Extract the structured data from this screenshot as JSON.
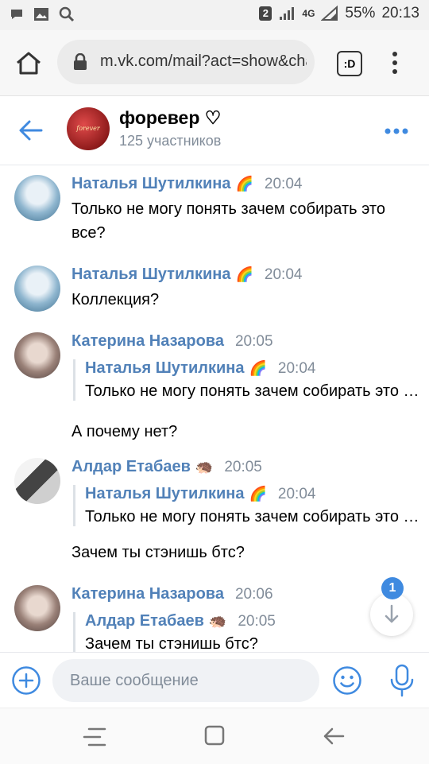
{
  "status_bar": {
    "notification_count": "2",
    "network": "4G",
    "battery": "55%",
    "time": "20:13",
    "icons": [
      "chat-bubble-icon",
      "image-icon",
      "search-icon",
      "signal-icon",
      "battery-icon"
    ]
  },
  "browser": {
    "url": "m.vk.com/mail?act=show&chat",
    "tab_label": ":D",
    "icons": [
      "home-icon",
      "lock-icon",
      "tab-switcher-icon",
      "overflow-menu-icon"
    ]
  },
  "chat": {
    "title": "форевер ♡",
    "participants": "125 участников",
    "avatar_text": "forever",
    "icons": [
      "back-arrow-icon",
      "more-dots-icon"
    ]
  },
  "messages": [
    {
      "author": "Наталья Шутилкина",
      "emoji": "🌈",
      "time": "20:04",
      "text": "Только не могу понять зачем собирать это все?"
    },
    {
      "author": "Наталья Шутилкина",
      "emoji": "🌈",
      "time": "20:04",
      "text": "Коллекция?"
    },
    {
      "author": "Катерина Назарова",
      "emoji": "",
      "time": "20:05",
      "quote": {
        "author": "Наталья Шутилкина",
        "emoji": "🌈",
        "time": "20:04",
        "text": "Только не могу понять зачем собирать это все?"
      },
      "text": "А почему нет?"
    },
    {
      "author": "Алдар Етабаев",
      "emoji": "🦔",
      "time": "20:05",
      "quote": {
        "author": "Наталья Шутилкина",
        "emoji": "🌈",
        "time": "20:04",
        "text": "Только не могу понять зачем собирать это все?"
      },
      "text": "Зачем ты стэнишь бтс?"
    },
    {
      "author": "Катерина Назарова",
      "emoji": "",
      "time": "20:06",
      "quote": {
        "author": "Алдар Етабаев",
        "emoji": "🦔",
        "time": "20:05",
        "text": "Зачем ты стэнишь бтс?"
      },
      "text": ""
    }
  ],
  "unread_count": "1",
  "composer": {
    "placeholder": "Ваше сообщение"
  },
  "colors": {
    "accent": "#5181b8",
    "icon_blue": "#3f8ae0",
    "secondary_text": "#818c99"
  }
}
